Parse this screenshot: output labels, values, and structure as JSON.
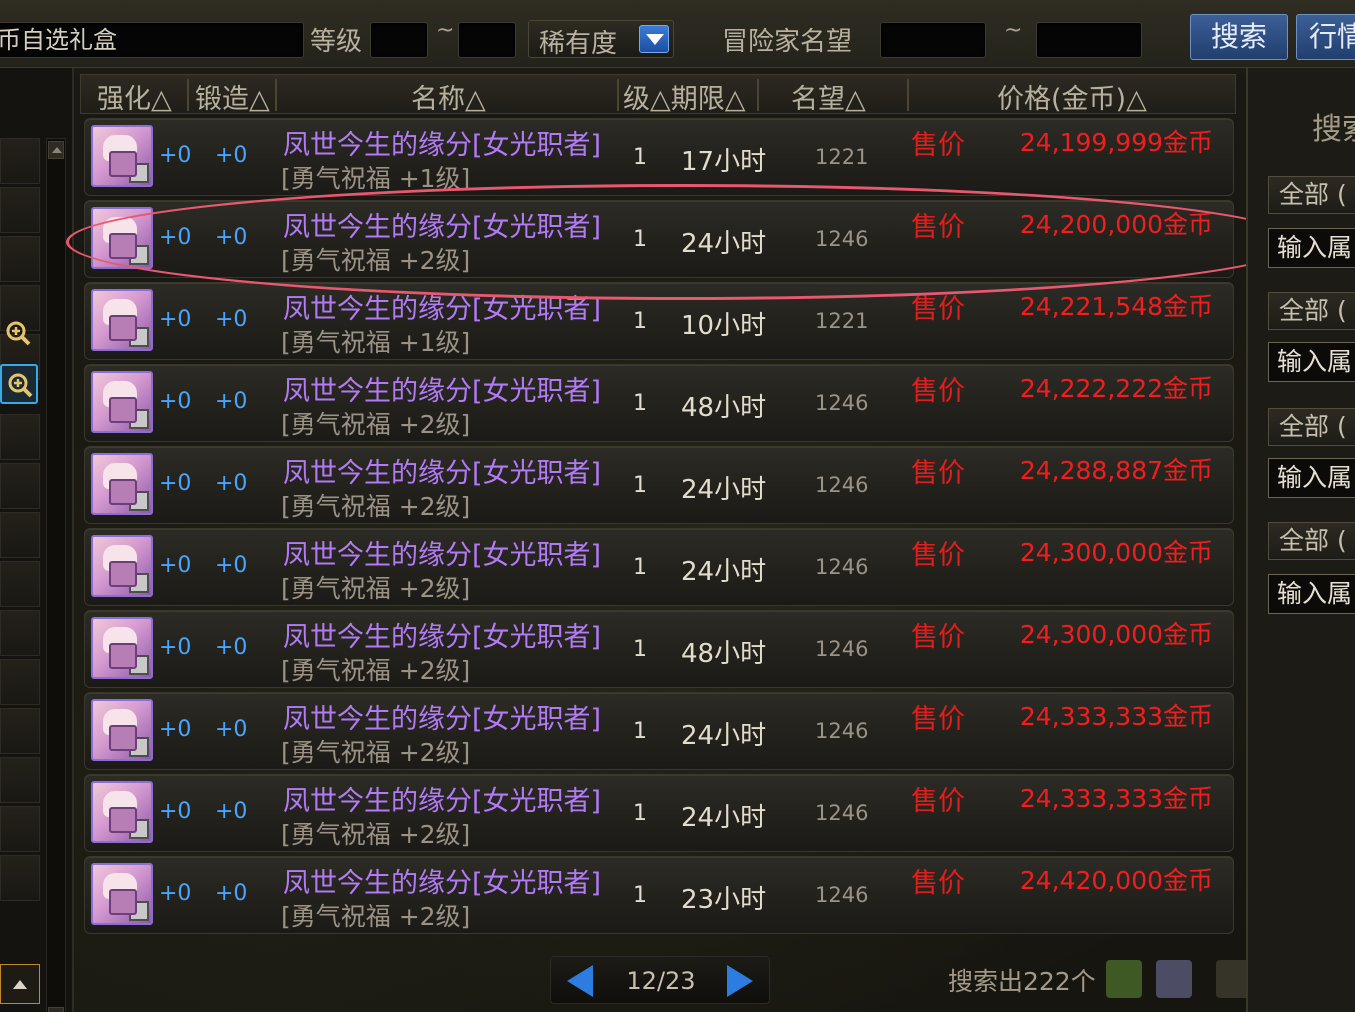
{
  "search": {
    "item_name": "币自选礼盒",
    "level_label": "等级",
    "level_min": "",
    "level_max": "",
    "range_sep": "~",
    "rarity_label": "稀有度",
    "fame_label": "冒险家名望",
    "fame_min": "",
    "fame_max": "",
    "search_button": "搜索",
    "market_button": "行情"
  },
  "table": {
    "headers": {
      "enhance": "强化△",
      "forge": "锻造△",
      "name": "名称△",
      "level_expire": "级△期限△",
      "fame": "名望△",
      "price": "价格(金币)△"
    },
    "rows": [
      {
        "enhance": "+0",
        "forge": "+0",
        "name": "凤世今生的缘分[女光职者]",
        "sub": "[勇气祝福 +1级]",
        "level": "1",
        "expire": "17小时",
        "fame": "1221",
        "sale_label": "售价",
        "price": "24,199,999金币"
      },
      {
        "enhance": "+0",
        "forge": "+0",
        "name": "凤世今生的缘分[女光职者]",
        "sub": "[勇气祝福 +2级]",
        "level": "1",
        "expire": "24小时",
        "fame": "1246",
        "sale_label": "售价",
        "price": "24,200,000金币"
      },
      {
        "enhance": "+0",
        "forge": "+0",
        "name": "凤世今生的缘分[女光职者]",
        "sub": "[勇气祝福 +1级]",
        "level": "1",
        "expire": "10小时",
        "fame": "1221",
        "sale_label": "售价",
        "price": "24,221,548金币"
      },
      {
        "enhance": "+0",
        "forge": "+0",
        "name": "凤世今生的缘分[女光职者]",
        "sub": "[勇气祝福 +2级]",
        "level": "1",
        "expire": "48小时",
        "fame": "1246",
        "sale_label": "售价",
        "price": "24,222,222金币"
      },
      {
        "enhance": "+0",
        "forge": "+0",
        "name": "凤世今生的缘分[女光职者]",
        "sub": "[勇气祝福 +2级]",
        "level": "1",
        "expire": "24小时",
        "fame": "1246",
        "sale_label": "售价",
        "price": "24,288,887金币"
      },
      {
        "enhance": "+0",
        "forge": "+0",
        "name": "凤世今生的缘分[女光职者]",
        "sub": "[勇气祝福 +2级]",
        "level": "1",
        "expire": "24小时",
        "fame": "1246",
        "sale_label": "售价",
        "price": "24,300,000金币"
      },
      {
        "enhance": "+0",
        "forge": "+0",
        "name": "凤世今生的缘分[女光职者]",
        "sub": "[勇气祝福 +2级]",
        "level": "1",
        "expire": "48小时",
        "fame": "1246",
        "sale_label": "售价",
        "price": "24,300,000金币"
      },
      {
        "enhance": "+0",
        "forge": "+0",
        "name": "凤世今生的缘分[女光职者]",
        "sub": "[勇气祝福 +2级]",
        "level": "1",
        "expire": "24小时",
        "fame": "1246",
        "sale_label": "售价",
        "price": "24,333,333金币"
      },
      {
        "enhance": "+0",
        "forge": "+0",
        "name": "凤世今生的缘分[女光职者]",
        "sub": "[勇气祝福 +2级]",
        "level": "1",
        "expire": "24小时",
        "fame": "1246",
        "sale_label": "售价",
        "price": "24,333,333金币"
      },
      {
        "enhance": "+0",
        "forge": "+0",
        "name": "凤世今生的缘分[女光职者]",
        "sub": "[勇气祝福 +2级]",
        "level": "1",
        "expire": "23小时",
        "fame": "1246",
        "sale_label": "售价",
        "price": "24,420,000金币"
      }
    ]
  },
  "pager": {
    "text": "12/23"
  },
  "result_text": "搜索出222个",
  "right_panel": {
    "title": "搜索",
    "filters": [
      {
        "select": "全部 (",
        "input": "输入属"
      },
      {
        "select": "全部 (",
        "input": "输入属"
      },
      {
        "select": "全部 (",
        "input": "输入属"
      },
      {
        "select": "全部 (",
        "input": "输入属"
      }
    ]
  },
  "colors": {
    "item_name": "#b27bf5",
    "price": "#f01e1e",
    "enhance": "#47a4ff",
    "highlight_ellipse": "#e8596f",
    "button_blue": "#2d5996"
  },
  "icons": [
    "zoom-in-icon",
    "scroll-up-icon",
    "scroll-down-icon",
    "prev-page-icon",
    "next-page-icon",
    "dropdown-arrow-icon"
  ]
}
